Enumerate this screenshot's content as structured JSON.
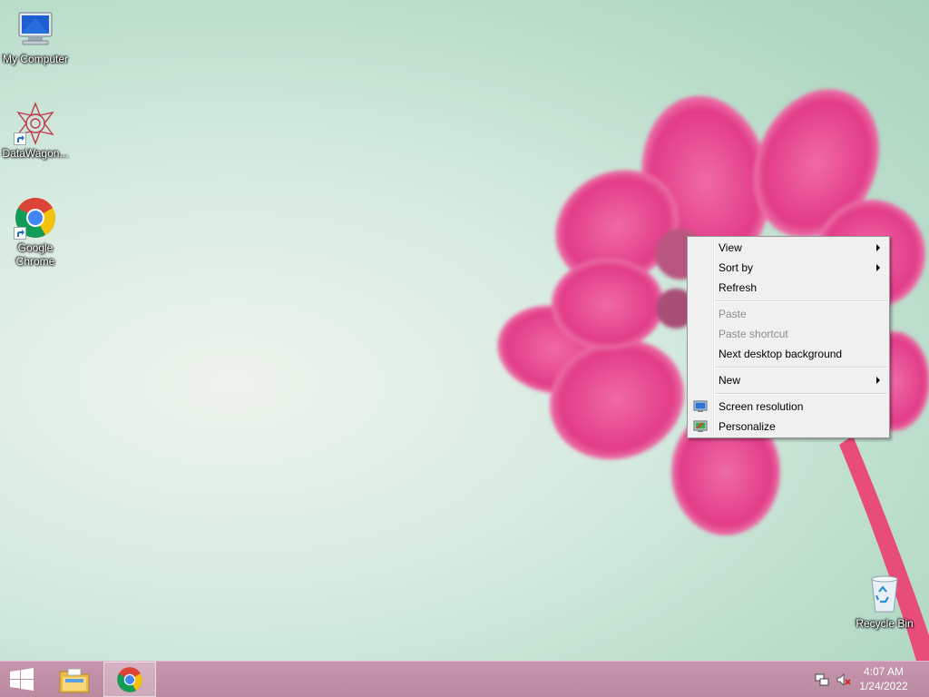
{
  "desktop": {
    "icons": [
      {
        "label": "My Computer"
      },
      {
        "label": "DataWagon..."
      },
      {
        "label": "Google Chrome"
      },
      {
        "label": "Recycle Bin"
      }
    ]
  },
  "context_menu": {
    "view": "View",
    "sort_by": "Sort by",
    "refresh": "Refresh",
    "paste": "Paste",
    "paste_shortcut": "Paste shortcut",
    "next_background": "Next desktop background",
    "new": "New",
    "screen_resolution": "Screen resolution",
    "personalize": "Personalize"
  },
  "taskbar": {
    "time": "4:07 AM",
    "date": "1/24/2022",
    "pinned": [
      "windows-start-icon",
      "file-explorer-icon",
      "chrome-icon"
    ],
    "tray": [
      "network-icon",
      "volume-muted-icon"
    ]
  },
  "colors": {
    "taskbar": "#c192a8",
    "wallpaper": "#c5e3d3",
    "flower": "#e63b8a"
  }
}
